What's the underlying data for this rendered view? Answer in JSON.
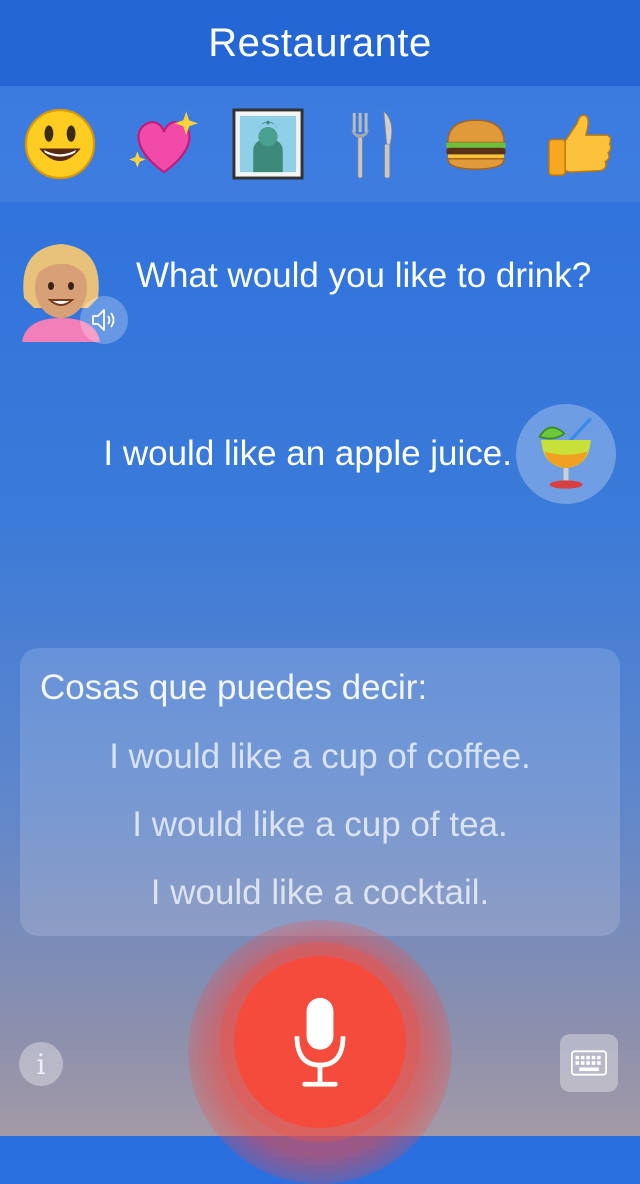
{
  "header": {
    "title": "Restaurante"
  },
  "topics": [
    {
      "icon": "smiley-emoji-icon"
    },
    {
      "icon": "sparkling-heart-emoji-icon"
    },
    {
      "icon": "statue-of-liberty-emoji-icon"
    },
    {
      "icon": "fork-and-knife-emoji-icon"
    },
    {
      "icon": "hamburger-emoji-icon"
    },
    {
      "icon": "thumbs-up-emoji-icon"
    }
  ],
  "conversation": {
    "bot_message": "What would you like to drink?",
    "bot_avatar": "woman-blonde-emoji-icon",
    "speaker_icon": "speaker-icon",
    "user_message": "I would like an apple juice.",
    "user_emoji": "tropical-drink-emoji-icon"
  },
  "suggestions": {
    "title": "Cosas que puedes decir:",
    "items": [
      "I would like a cup of coffee.",
      "I would like a cup of tea.",
      "I would like a cocktail."
    ]
  },
  "controls": {
    "info_label": "i",
    "mic_icon": "microphone-icon",
    "keyboard_icon": "keyboard-icon"
  },
  "colors": {
    "header": "#2466d4",
    "mic": "#f44b3c"
  }
}
